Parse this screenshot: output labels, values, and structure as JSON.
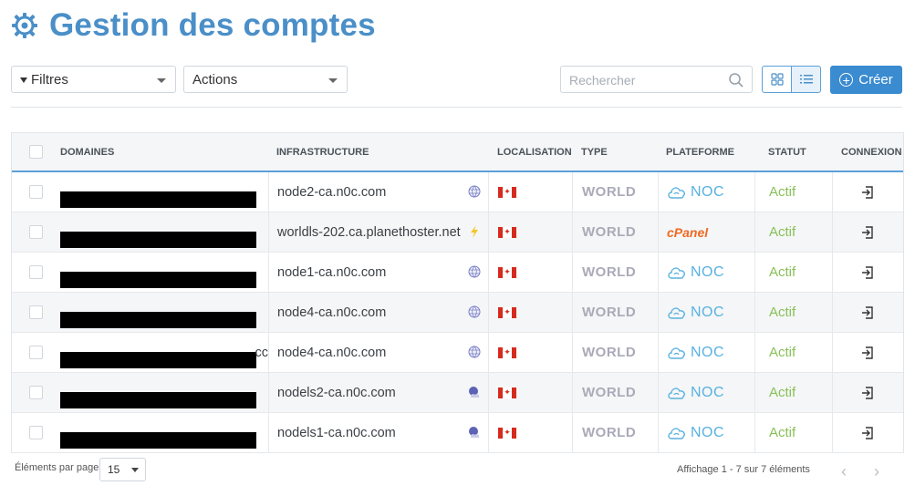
{
  "page": {
    "title": "Gestion des comptes"
  },
  "toolbar": {
    "filters_label": "Filtres",
    "actions_label": "Actions",
    "search_placeholder": "Rechercher",
    "create_label": "Créer"
  },
  "table": {
    "headers": {
      "domains": "DOMAINES",
      "infrastructure": "INFRASTRUCTURE",
      "location": "LOCALISATION",
      "type": "TYPE",
      "platform": "PLATEFORME",
      "status": "STATUT",
      "login": "CONNEXION"
    },
    "rows": [
      {
        "infrastructure": "node2-ca.n0c.com",
        "infra_icon": "globe-icon",
        "type": "WORLD",
        "platform": "NOC",
        "status": "Actif"
      },
      {
        "infrastructure": "worldls-202.ca.planethoster.net",
        "infra_icon": "lightning-icon",
        "type": "WORLD",
        "platform": "cPanel",
        "status": "Actif"
      },
      {
        "infrastructure": "node1-ca.n0c.com",
        "infra_icon": "globe-icon",
        "type": "WORLD",
        "platform": "NOC",
        "status": "Actif"
      },
      {
        "infrastructure": "node4-ca.n0c.com",
        "infra_icon": "globe-icon",
        "type": "WORLD",
        "platform": "NOC",
        "status": "Actif"
      },
      {
        "infrastructure": "node4-ca.n0c.com",
        "infra_icon": "globe-icon",
        "type": "WORLD",
        "platform": "NOC",
        "status": "Actif",
        "domain_overflow": "cc"
      },
      {
        "infrastructure": "nodels2-ca.n0c.com",
        "infra_icon": "cloud-moon-icon",
        "type": "WORLD",
        "platform": "NOC",
        "status": "Actif"
      },
      {
        "infrastructure": "nodels1-ca.n0c.com",
        "infra_icon": "cloud-moon-icon",
        "type": "WORLD",
        "platform": "NOC",
        "status": "Actif"
      }
    ]
  },
  "footer": {
    "per_page_label": "Éléments par page",
    "per_page_value": "15",
    "range_text": "Affichage 1 - 7 sur 7 éléments"
  },
  "colors": {
    "brand": "#4a8fc8",
    "primary_button": "#3a8bd0",
    "status_active": "#88c057",
    "noc": "#59b1e0",
    "cpanel": "#ef6a23",
    "world": "#aaaab8",
    "flag_red": "#d52b1e"
  }
}
